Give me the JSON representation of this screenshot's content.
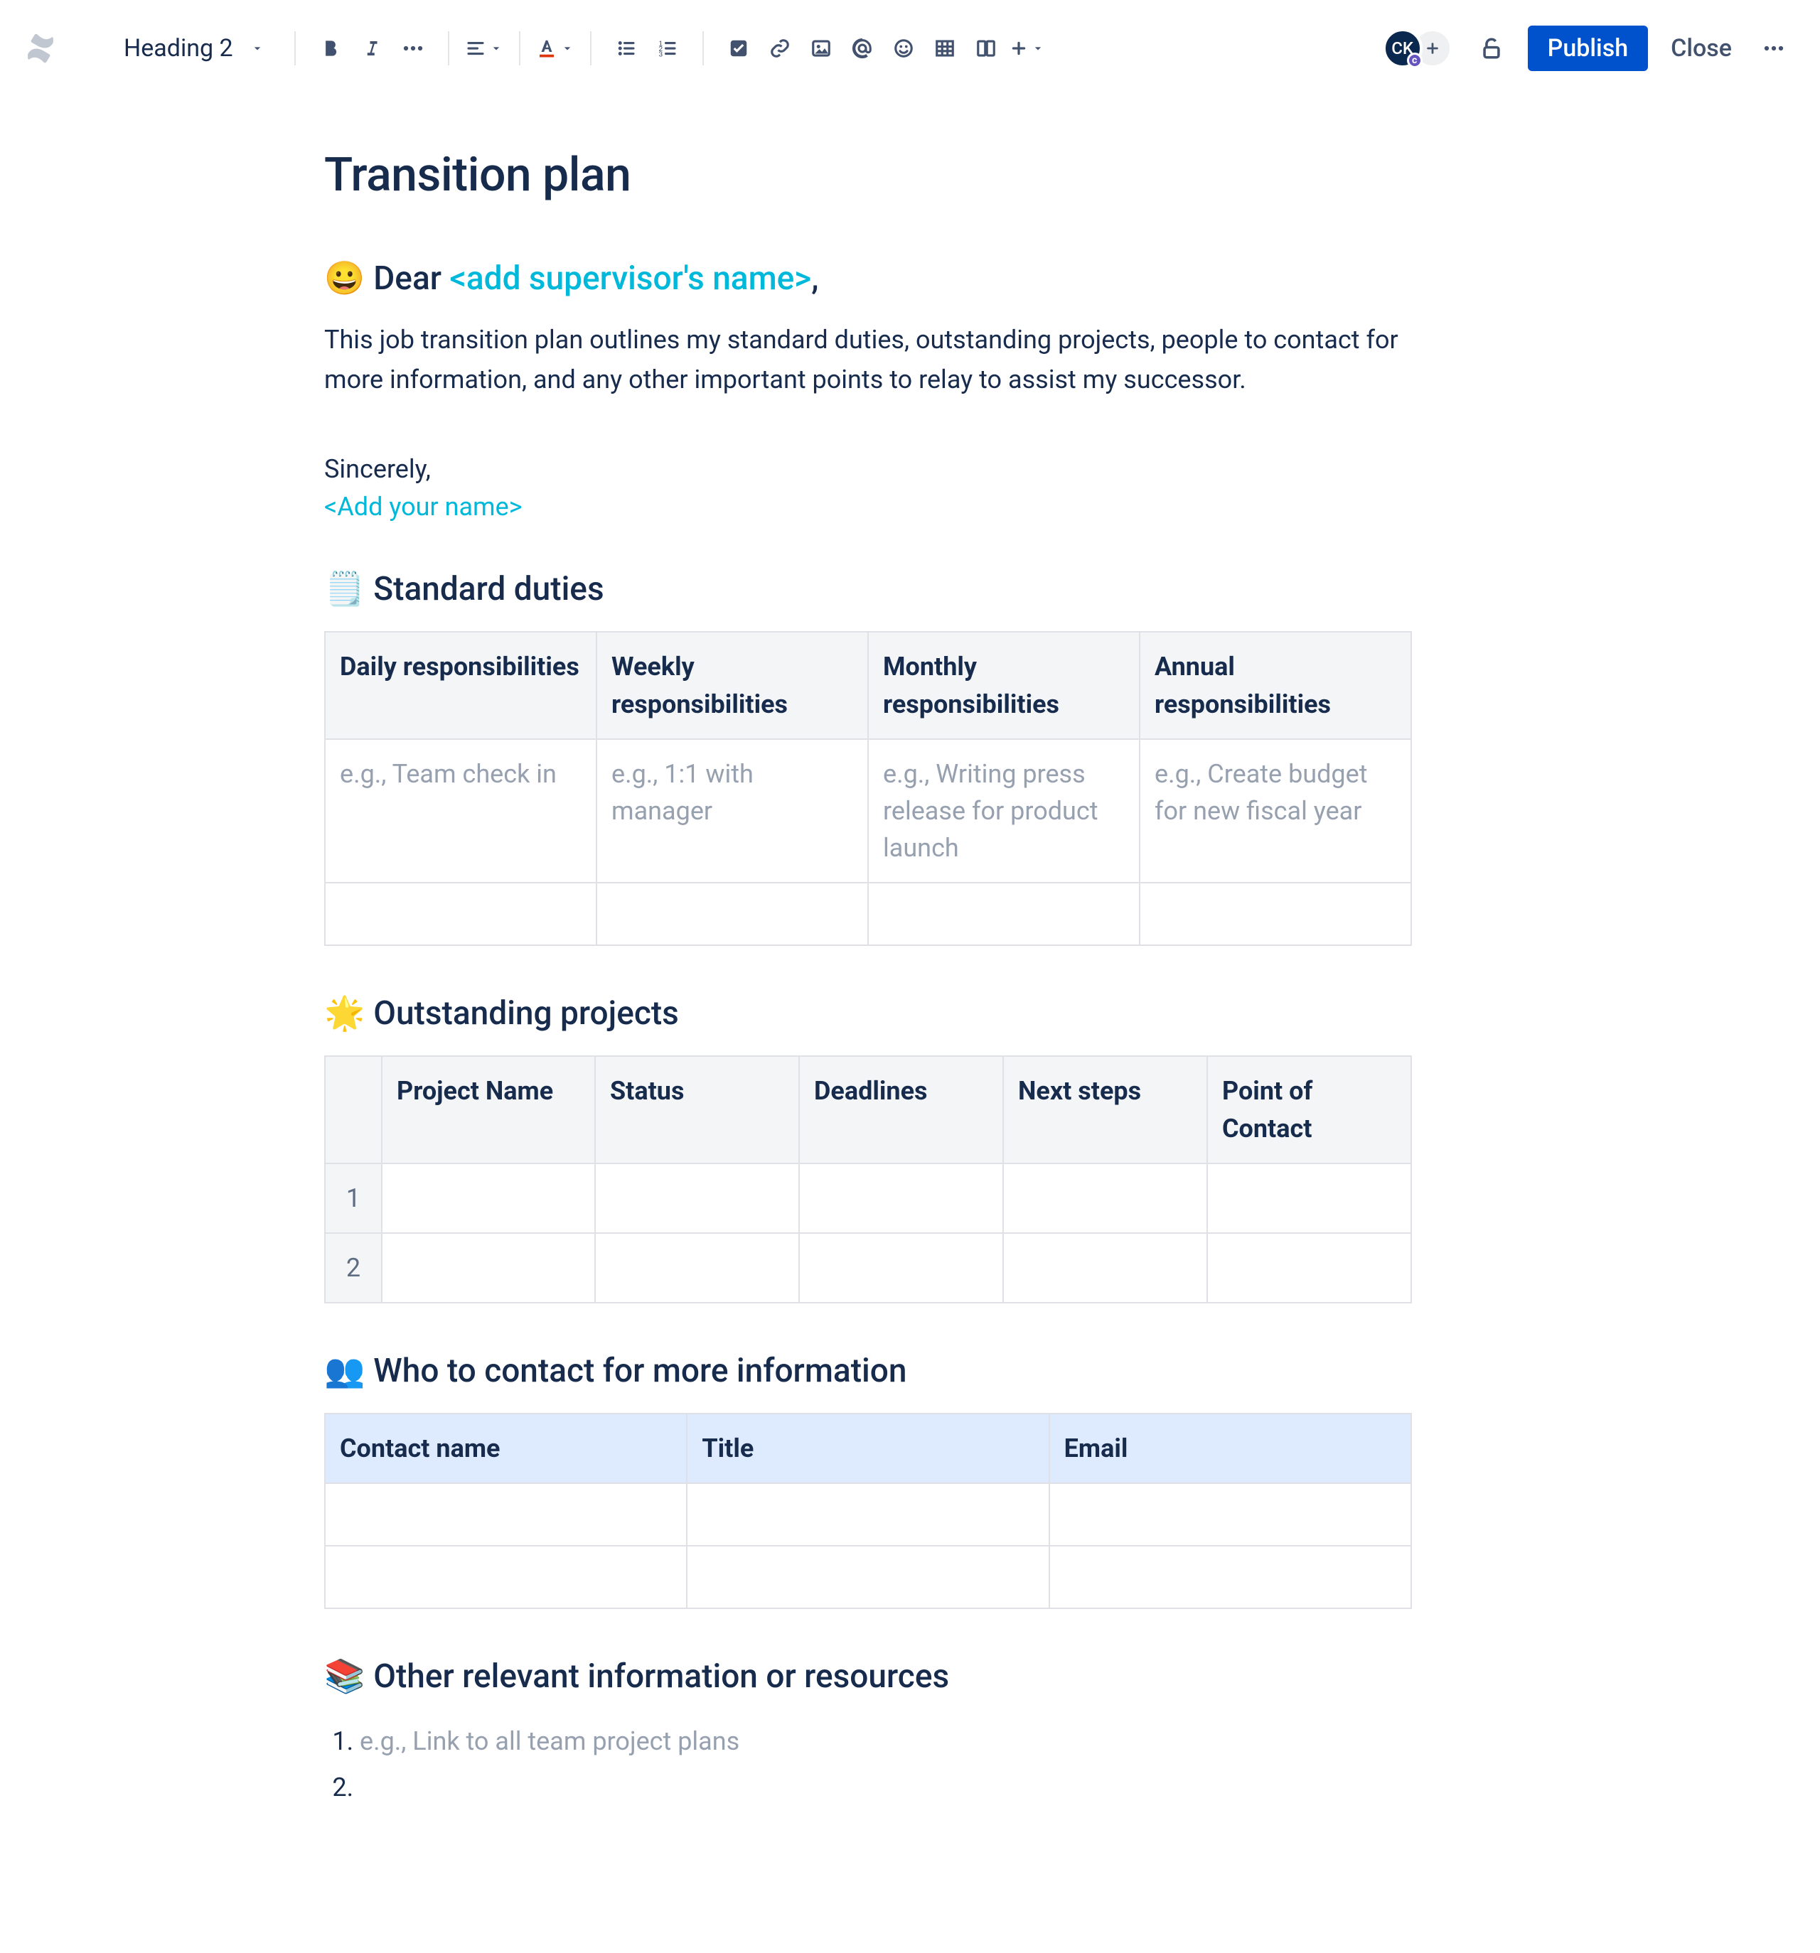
{
  "toolbar": {
    "text_style": "Heading 2",
    "avatar_initials": "CK",
    "avatar_badge": "c",
    "publish_label": "Publish",
    "close_label": "Close"
  },
  "document": {
    "title": "Transition plan",
    "greeting": {
      "emoji": "😀",
      "prefix": "Dear ",
      "placeholder": "<add supervisor's name>",
      "suffix": ","
    },
    "intro": "This job transition plan outlines my standard duties, outstanding projects, people to contact for more information, and any other important points to relay to assist my successor.",
    "signoff": "Sincerely,",
    "name_placeholder": "<Add your name>",
    "sections": {
      "duties": {
        "emoji": "🗒️",
        "heading": "Standard duties",
        "headers": [
          "Daily responsibilities",
          "Weekly responsibilities",
          "Monthly responsibilities",
          "Annual responsibilities"
        ],
        "row1": [
          "e.g., Team check in",
          "e.g., 1:1 with manager",
          "e.g., Writing press release for product launch",
          "e.g., Create budget for new fiscal year"
        ]
      },
      "projects": {
        "emoji": "🌟",
        "heading": "Outstanding projects",
        "headers": [
          "Project Name",
          "Status",
          "Deadlines",
          "Next steps",
          "Point of Contact"
        ],
        "rownums": [
          "1",
          "2"
        ]
      },
      "contacts": {
        "emoji": "👥",
        "heading": "Who to contact for more information",
        "headers": [
          "Contact name",
          "Title",
          "Email"
        ]
      },
      "resources": {
        "emoji": "📚",
        "heading": "Other relevant information or resources",
        "item1": "e.g., Link to all team project plans"
      }
    }
  }
}
